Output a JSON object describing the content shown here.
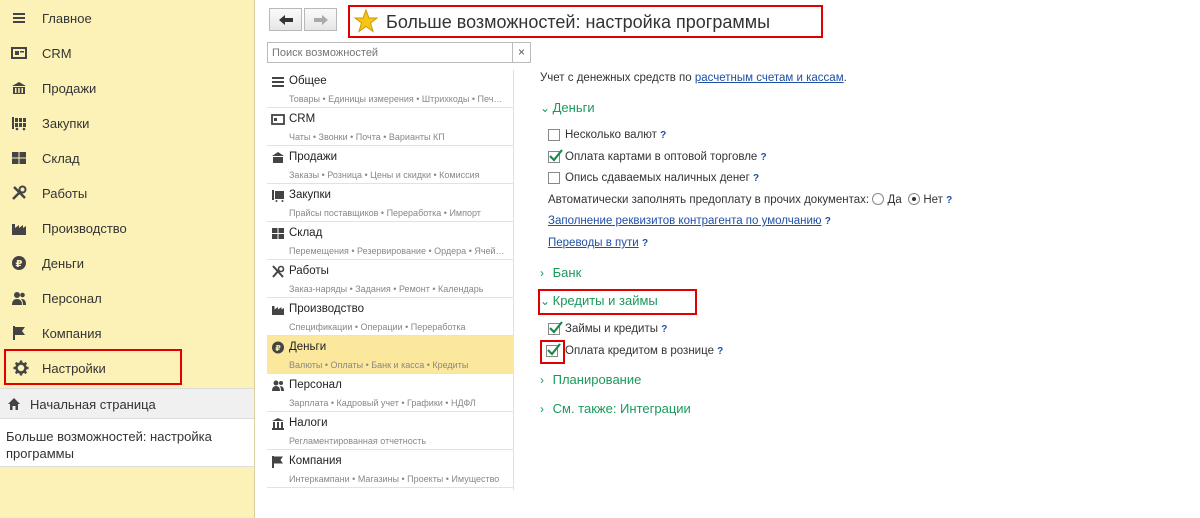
{
  "sidebar": {
    "items": [
      {
        "label": "Главное",
        "icon": "menu-lines-icon"
      },
      {
        "label": "CRM",
        "icon": "crm-card-icon"
      },
      {
        "label": "Продажи",
        "icon": "shop-basket-icon"
      },
      {
        "label": "Закупки",
        "icon": "purchase-grid-icon"
      },
      {
        "label": "Склад",
        "icon": "warehouse-grid-icon"
      },
      {
        "label": "Работы",
        "icon": "tools-icon"
      },
      {
        "label": "Производство",
        "icon": "factory-icon"
      },
      {
        "label": "Деньги",
        "icon": "ruble-coin-icon"
      },
      {
        "label": "Персонал",
        "icon": "people-icon"
      },
      {
        "label": "Компания",
        "icon": "flag-icon"
      },
      {
        "label": "Настройки",
        "icon": "gear-icon"
      }
    ],
    "home": "Начальная страница",
    "open_window": "Больше возможностей: настройка программы"
  },
  "header": {
    "title": "Больше возможностей: настройка программы",
    "search_placeholder": "Поиск возможностей",
    "clear": "×"
  },
  "categories": [
    {
      "title": "Общее",
      "sub": "Товары • Единицы измерения • Штрихкоды • Печ…"
    },
    {
      "title": "CRM",
      "sub": "Чаты • Звонки • Почта • Варианты КП"
    },
    {
      "title": "Продажи",
      "sub": "Заказы • Розница • Цены и скидки • Комиссия"
    },
    {
      "title": "Закупки",
      "sub": "Прайсы поставщиков • Переработка • Импорт"
    },
    {
      "title": "Склад",
      "sub": "Перемещения • Резервирование • Ордера • Ячей…"
    },
    {
      "title": "Работы",
      "sub": "Заказ-наряды • Задания • Ремонт • Календарь"
    },
    {
      "title": "Производство",
      "sub": "Спецификации • Операции • Переработка"
    },
    {
      "title": "Деньги",
      "sub": "Валюты • Оплаты • Банк и касса • Кредиты"
    },
    {
      "title": "Персонал",
      "sub": "Зарплата • Кадровый учет • Графики • НДФЛ"
    },
    {
      "title": "Налоги",
      "sub": "Регламентированная отчетность"
    },
    {
      "title": "Компания",
      "sub": "Интеркампани • Магазины • Проекты • Имущество"
    }
  ],
  "settings": {
    "intro_text": "Учет с денежных средств по ",
    "intro_link": "расчетным счетам и кассам",
    "intro_end": ".",
    "money_section": "Деньги",
    "multi_currency": "Несколько валют",
    "card_payment": "Оплата картами в оптовой торговле",
    "cash_inventory": "Опись сдаваемых наличных денег",
    "autofill_prepay": "Автоматически заполнять предоплату в прочих документах:",
    "yes": "Да",
    "no": "Нет",
    "fill_details_link": "Заполнение реквизитов контрагента по умолчанию",
    "transfers_link": "Переводы в пути",
    "bank_section": "Банк",
    "credits_section": "Кредиты и займы",
    "loans": "Займы и кредиты",
    "credit_retail": "Оплата кредитом в рознице",
    "planning_section": "Планирование",
    "see_also_section": "См. также: Интеграции",
    "help": "?"
  },
  "state": {
    "multi_currency": false,
    "card_payment": true,
    "cash_inventory": false,
    "autofill_prepay": "Нет",
    "loans": true,
    "credit_retail": true
  },
  "colors": {
    "sidebar_bg": "#fcf2b8",
    "accent_green": "#1a9a5a",
    "link_blue": "#1f4fa3",
    "highlight_red": "#e00000",
    "selected_row": "#fbe89c"
  }
}
